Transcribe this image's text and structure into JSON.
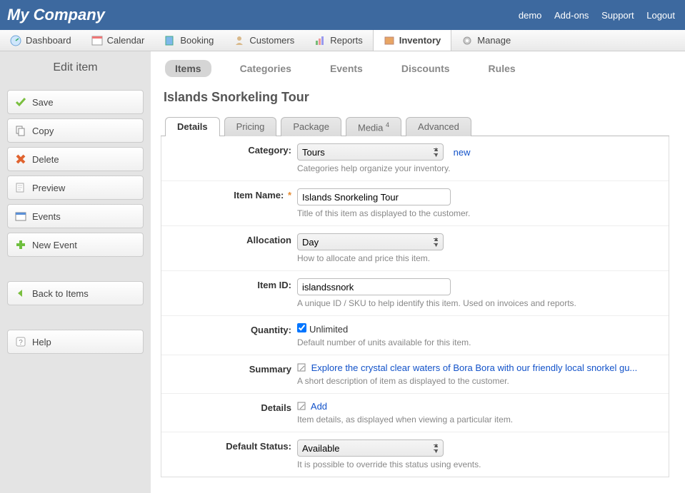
{
  "header": {
    "company": "My Company",
    "links": [
      "demo",
      "Add-ons",
      "Support",
      "Logout"
    ]
  },
  "mainnav": [
    {
      "label": "Dashboard",
      "icon": "dashboard"
    },
    {
      "label": "Calendar",
      "icon": "calendar"
    },
    {
      "label": "Booking",
      "icon": "booking"
    },
    {
      "label": "Customers",
      "icon": "customers"
    },
    {
      "label": "Reports",
      "icon": "reports"
    },
    {
      "label": "Inventory",
      "icon": "inventory"
    },
    {
      "label": "Manage",
      "icon": "manage"
    }
  ],
  "mainnav_active": 5,
  "sidebar": {
    "title": "Edit item",
    "buttons": [
      {
        "label": "Save",
        "icon": "check"
      },
      {
        "label": "Copy",
        "icon": "copy"
      },
      {
        "label": "Delete",
        "icon": "delete"
      },
      {
        "label": "Preview",
        "icon": "preview"
      },
      {
        "label": "Events",
        "icon": "events"
      },
      {
        "label": "New Event",
        "icon": "plus"
      }
    ],
    "back": {
      "label": "Back to Items",
      "icon": "back"
    },
    "help": {
      "label": "Help",
      "icon": "help"
    }
  },
  "subnav": [
    "Items",
    "Categories",
    "Events",
    "Discounts",
    "Rules"
  ],
  "subnav_active": 0,
  "page_title": "Islands Snorkeling Tour",
  "tabs": [
    {
      "label": "Details"
    },
    {
      "label": "Pricing"
    },
    {
      "label": "Package"
    },
    {
      "label": "Media",
      "badge": "4"
    },
    {
      "label": "Advanced"
    }
  ],
  "tabs_active": 0,
  "form": {
    "category": {
      "label": "Category:",
      "value": "Tours",
      "new": "new",
      "hint": "Categories help organize your inventory."
    },
    "item_name": {
      "label": "Item Name:",
      "value": "Islands Snorkeling Tour",
      "hint": "Title of this item as displayed to the customer."
    },
    "allocation": {
      "label": "Allocation",
      "value": "Day",
      "hint": "How to allocate and price this item."
    },
    "item_id": {
      "label": "Item ID:",
      "value": "islandssnork",
      "hint": "A unique ID / SKU to help identify this item. Used on invoices and reports."
    },
    "quantity": {
      "label": "Quantity:",
      "checkbox_label": "Unlimited",
      "checked": true,
      "hint": "Default number of units available for this item."
    },
    "summary": {
      "label": "Summary",
      "link": "Explore the crystal clear waters of Bora Bora with our friendly local snorkel gu...",
      "hint": "A short description of item as displayed to the customer."
    },
    "details": {
      "label": "Details",
      "link": "Add",
      "hint": "Item details, as displayed when viewing a particular item."
    },
    "status": {
      "label": "Default Status:",
      "value": "Available",
      "hint": "It is possible to override this status using events."
    }
  }
}
